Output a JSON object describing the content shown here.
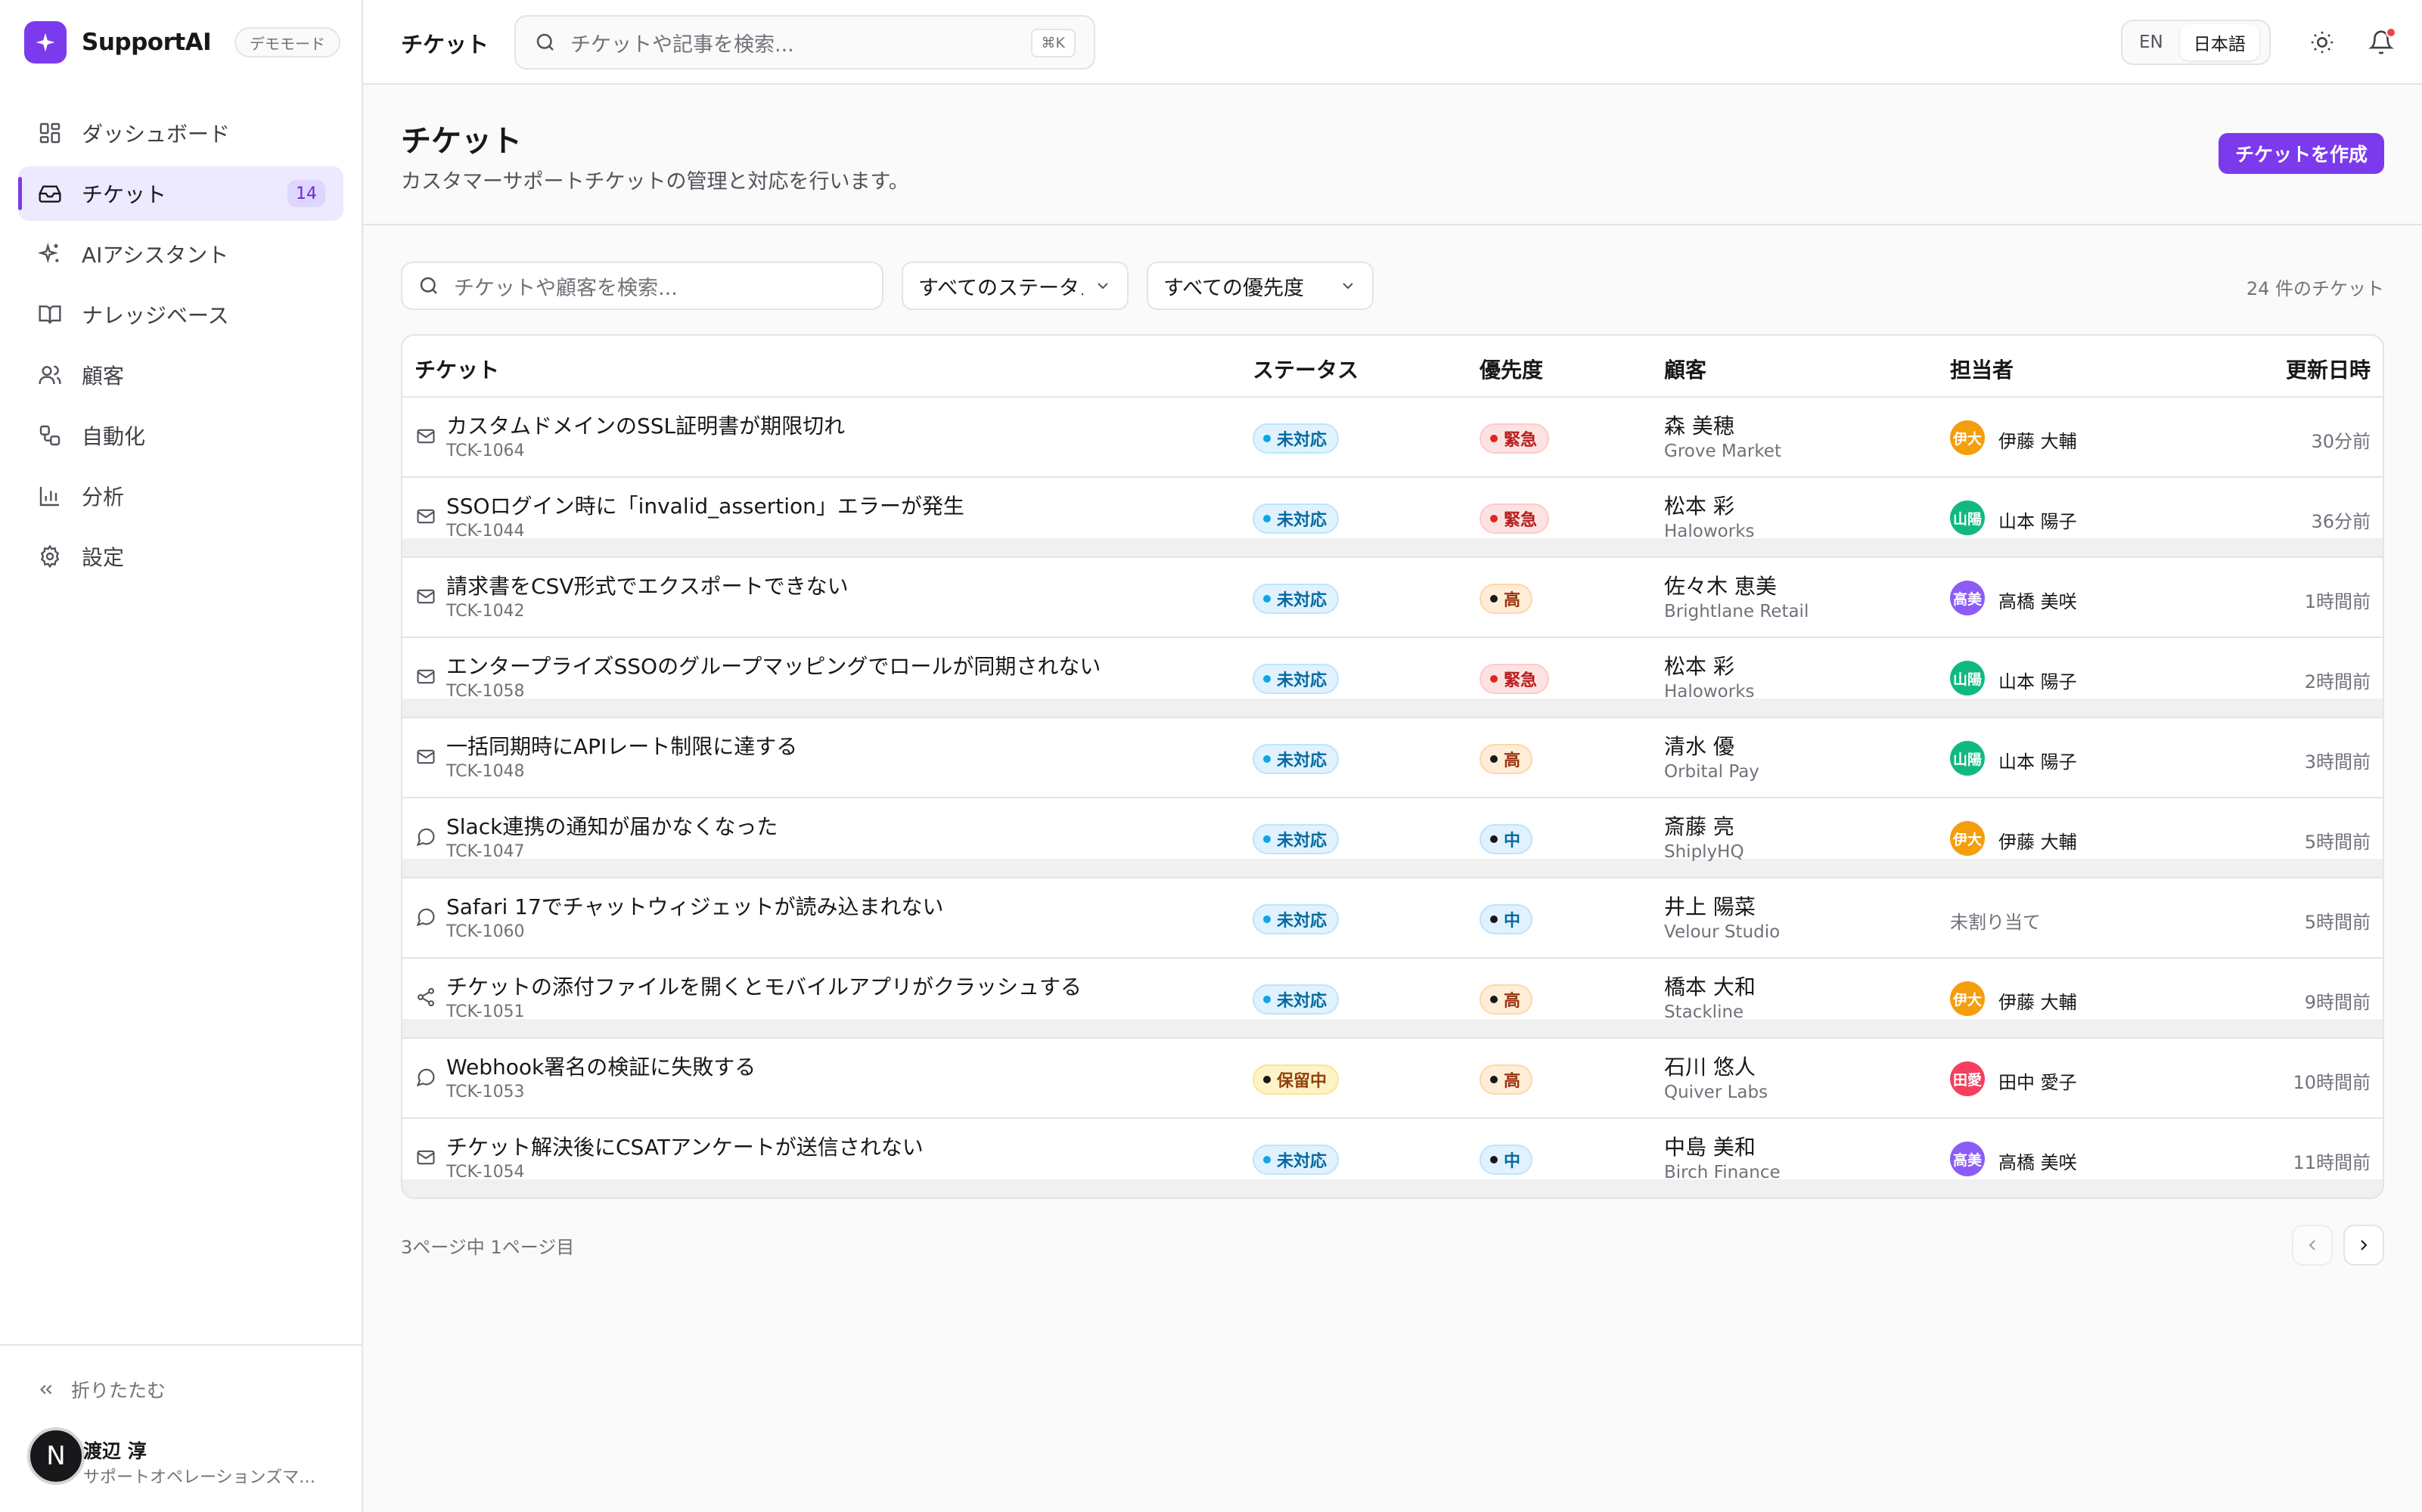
{
  "app": {
    "brand_name": "SupportAI",
    "demo_badge": "デモモード",
    "accent_color": "#7c3aed"
  },
  "sidebar": {
    "items": [
      {
        "label": "ダッシュボード",
        "icon": "dashboard-icon"
      },
      {
        "label": "チケット",
        "icon": "inbox-icon",
        "count": "14",
        "active": true
      },
      {
        "label": "AIアシスタント",
        "icon": "sparkles-icon"
      },
      {
        "label": "ナレッジベース",
        "icon": "book-icon"
      },
      {
        "label": "顧客",
        "icon": "users-icon"
      },
      {
        "label": "自動化",
        "icon": "workflow-icon"
      },
      {
        "label": "分析",
        "icon": "bar-chart-icon"
      },
      {
        "label": "設定",
        "icon": "gear-icon"
      }
    ],
    "collapse_label": "折りたたむ",
    "user": {
      "initial": "N",
      "name": "渡辺 淳",
      "role": "サポートオペレーションズマネージャー"
    }
  },
  "topbar": {
    "title": "チケット",
    "search_placeholder": "チケットや記事を検索...",
    "shortcut": "⌘K",
    "lang_en": "EN",
    "lang_ja": "日本語",
    "active_lang": "日本語"
  },
  "page": {
    "title": "チケット",
    "subtitle": "カスタマーサポートチケットの管理と対応を行います。",
    "create_button": "チケットを作成"
  },
  "filters": {
    "search_placeholder": "チケットや顧客を検索...",
    "status_select": "すべてのステータス",
    "priority_select": "すべての優先度",
    "ticket_count": "24 件のチケット"
  },
  "table": {
    "headers": {
      "ticket": "チケット",
      "status": "ステータス",
      "priority": "優先度",
      "customer": "顧客",
      "assignee": "担当者",
      "updated": "更新日時"
    },
    "rows": [
      {
        "channel": "mail-icon",
        "title": "カスタムドメインのSSL証明書が期限切れ",
        "id": "TCK-1064",
        "status": "未対応",
        "priority": "緊急",
        "customer": "森 美穂",
        "org": "Grove Market",
        "assignee_initials": "伊大",
        "assignee": "伊藤 大輔",
        "updated": "30分前"
      },
      {
        "channel": "mail-icon",
        "title": "SSOログイン時に「invalid_assertion」エラーが発生",
        "id": "TCK-1044",
        "status": "未対応",
        "priority": "緊急",
        "customer": "松本 彩",
        "org": "Haloworks",
        "assignee_initials": "山陽",
        "assignee": "山本 陽子",
        "updated": "36分前"
      },
      {
        "channel": "mail-icon",
        "title": "請求書をCSV形式でエクスポートできない",
        "id": "TCK-1042",
        "status": "未対応",
        "priority": "高",
        "customer": "佐々木 恵美",
        "org": "Brightlane Retail",
        "assignee_initials": "高美",
        "assignee": "高橋 美咲",
        "updated": "1時間前"
      },
      {
        "channel": "mail-icon",
        "title": "エンタープライズSSOのグループマッピングでロールが同期されない",
        "id": "TCK-1058",
        "status": "未対応",
        "priority": "緊急",
        "customer": "松本 彩",
        "org": "Haloworks",
        "assignee_initials": "山陽",
        "assignee": "山本 陽子",
        "updated": "2時間前"
      },
      {
        "channel": "mail-icon",
        "title": "一括同期時にAPIレート制限に達する",
        "id": "TCK-1048",
        "status": "未対応",
        "priority": "高",
        "customer": "清水 優",
        "org": "Orbital Pay",
        "assignee_initials": "山陽",
        "assignee": "山本 陽子",
        "updated": "3時間前"
      },
      {
        "channel": "chat-icon",
        "title": "Slack連携の通知が届かなくなった",
        "id": "TCK-1047",
        "status": "未対応",
        "priority": "中",
        "customer": "斎藤 亮",
        "org": "ShiplyHQ",
        "assignee_initials": "伊大",
        "assignee": "伊藤 大輔",
        "updated": "5時間前"
      },
      {
        "channel": "chat-icon",
        "title": "Safari 17でチャットウィジェットが読み込まれない",
        "id": "TCK-1060",
        "status": "未対応",
        "priority": "中",
        "customer": "井上 陽菜",
        "org": "Velour Studio",
        "assignee_initials": "",
        "assignee": "未割り当て",
        "updated": "5時間前"
      },
      {
        "channel": "share-icon",
        "title": "チケットの添付ファイルを開くとモバイルアプリがクラッシュする",
        "id": "TCK-1051",
        "status": "未対応",
        "priority": "高",
        "customer": "橋本 大和",
        "org": "Stackline",
        "assignee_initials": "伊大",
        "assignee": "伊藤 大輔",
        "updated": "9時間前"
      },
      {
        "channel": "chat-icon",
        "title": "Webhook署名の検証に失敗する",
        "id": "TCK-1053",
        "status": "保留中",
        "priority": "高",
        "customer": "石川 悠人",
        "org": "Quiver Labs",
        "assignee_initials": "田愛",
        "assignee": "田中 愛子",
        "updated": "10時間前"
      },
      {
        "channel": "mail-icon",
        "title": "チケット解決後にCSATアンケートが送信されない",
        "id": "TCK-1054",
        "status": "未対応",
        "priority": "中",
        "customer": "中島 美和",
        "org": "Birch Finance",
        "assignee_initials": "高美",
        "assignee": "高橋 美咲",
        "updated": "11時間前"
      }
    ]
  },
  "pagination": {
    "info": "3ページ中 1ページ目"
  },
  "assignee_colors": {
    "伊大": "#f59e0b",
    "山陽": "#10b981",
    "高美": "#8b5cf6",
    "田愛": "#f43f5e"
  }
}
